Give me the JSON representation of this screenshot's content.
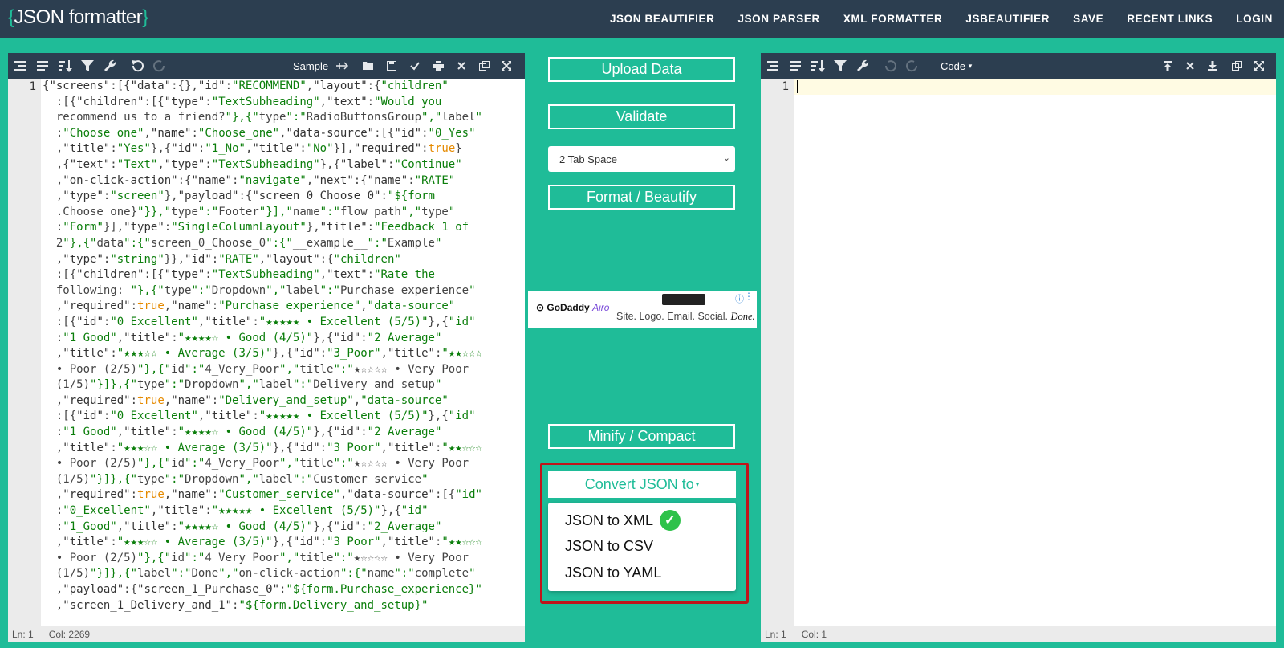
{
  "header": {
    "logo_open": "{",
    "logo_name": "JSON formatter",
    "logo_close": "}",
    "nav": [
      "JSON BEAUTIFIER",
      "JSON PARSER",
      "XML FORMATTER",
      "JSBEAUTIFIER",
      "SAVE",
      "RECENT LINKS",
      "LOGIN"
    ]
  },
  "left_editor": {
    "sample_label": "Sample",
    "line_number": "1",
    "status": {
      "ln": "Ln: 1",
      "col": "Col: 2269"
    }
  },
  "right_editor": {
    "mode_label": "Code",
    "line_number": "1",
    "status": {
      "ln": "Ln: 1",
      "col": "Col: 1"
    }
  },
  "actions": {
    "upload": "Upload Data",
    "validate": "Validate",
    "tab_select": "2 Tab Space",
    "format": "Format / Beautify",
    "minify": "Minify / Compact",
    "convert": "Convert JSON to",
    "convert_options": [
      "JSON to XML",
      "JSON to CSV",
      "JSON to YAML"
    ]
  },
  "ad": {
    "brand": "GoDaddy",
    "brand_suffix": "Airo",
    "tagline": "Site. Logo. Email. Social.",
    "tagline_end": "Done."
  },
  "code_lines": [
    "{\"screens\":[{\"data\":{},\"id\":\"RECOMMEND\",\"layout\":{\"children\"",
    "  :[{\"children\":[{\"type\":\"TextSubheading\",\"text\":\"Would you",
    "  recommend us to a friend?\"},{\"type\":\"RadioButtonsGroup\",\"label\"",
    "  :\"Choose one\",\"name\":\"Choose_one\",\"data-source\":[{\"id\":\"0_Yes\"",
    "  ,\"title\":\"Yes\"},{\"id\":\"1_No\",\"title\":\"No\"}],\"required\":true}",
    "  ,{\"text\":\"Text\",\"type\":\"TextSubheading\"},{\"label\":\"Continue\"",
    "  ,\"on-click-action\":{\"name\":\"navigate\",\"next\":{\"name\":\"RATE\"",
    "  ,\"type\":\"screen\"},\"payload\":{\"screen_0_Choose_0\":\"${form",
    "  .Choose_one}\"}},\"type\":\"Footer\"}],\"name\":\"flow_path\",\"type\"",
    "  :\"Form\"}],\"type\":\"SingleColumnLayout\"},\"title\":\"Feedback 1 of",
    "  2\"},{\"data\":{\"screen_0_Choose_0\":{\"__example__\":\"Example\"",
    "  ,\"type\":\"string\"}},\"id\":\"RATE\",\"layout\":{\"children\"",
    "  :[{\"children\":[{\"type\":\"TextSubheading\",\"text\":\"Rate the",
    "  following: \"},{\"type\":\"Dropdown\",\"label\":\"Purchase experience\"",
    "  ,\"required\":true,\"name\":\"Purchase_experience\",\"data-source\"",
    "  :[{\"id\":\"0_Excellent\",\"title\":\"★★★★★ • Excellent (5/5)\"},{\"id\"",
    "  :\"1_Good\",\"title\":\"★★★★☆ • Good (4/5)\"},{\"id\":\"2_Average\"",
    "  ,\"title\":\"★★★☆☆ • Average (3/5)\"},{\"id\":\"3_Poor\",\"title\":\"★★☆☆☆",
    "  • Poor (2/5)\"},{\"id\":\"4_Very_Poor\",\"title\":\"★☆☆☆☆ • Very Poor",
    "  (1/5)\"}]},{\"type\":\"Dropdown\",\"label\":\"Delivery and setup\"",
    "  ,\"required\":true,\"name\":\"Delivery_and_setup\",\"data-source\"",
    "  :[{\"id\":\"0_Excellent\",\"title\":\"★★★★★ • Excellent (5/5)\"},{\"id\"",
    "  :\"1_Good\",\"title\":\"★★★★☆ • Good (4/5)\"},{\"id\":\"2_Average\"",
    "  ,\"title\":\"★★★☆☆ • Average (3/5)\"},{\"id\":\"3_Poor\",\"title\":\"★★☆☆☆",
    "  • Poor (2/5)\"},{\"id\":\"4_Very_Poor\",\"title\":\"★☆☆☆☆ • Very Poor",
    "  (1/5)\"}]},{\"type\":\"Dropdown\",\"label\":\"Customer service\"",
    "  ,\"required\":true,\"name\":\"Customer_service\",\"data-source\":[{\"id\"",
    "  :\"0_Excellent\",\"title\":\"★★★★★ • Excellent (5/5)\"},{\"id\"",
    "  :\"1_Good\",\"title\":\"★★★★☆ • Good (4/5)\"},{\"id\":\"2_Average\"",
    "  ,\"title\":\"★★★☆☆ • Average (3/5)\"},{\"id\":\"3_Poor\",\"title\":\"★★☆☆☆",
    "  • Poor (2/5)\"},{\"id\":\"4_Very_Poor\",\"title\":\"★☆☆☆☆ • Very Poor",
    "  (1/5)\"}]},{\"label\":\"Done\",\"on-click-action\":{\"name\":\"complete\"",
    "  ,\"payload\":{\"screen_1_Purchase_0\":\"${form.Purchase_experience}\"",
    "  ,\"screen_1_Delivery_and_1\":\"${form.Delivery_and_setup}\""
  ],
  "colors": {
    "teal": "#1fbc98",
    "navy": "#2c3e50",
    "string": "#0b7e0b",
    "boolean": "#e58a00",
    "highlight": "#c0141a",
    "check": "#2ec24a"
  },
  "icons": {
    "left_toolbar": [
      "format-icon",
      "compact-icon",
      "sort-icon",
      "filter-icon",
      "wrench-icon",
      "undo-icon",
      "redo-icon"
    ],
    "left_right_toolbar": [
      "sample-icon",
      "open-folder-icon",
      "save-icon",
      "check-icon",
      "print-icon",
      "close-icon",
      "copy-icon",
      "fullscreen-icon"
    ],
    "right_toolbar": [
      "format-icon",
      "compact-icon",
      "sort-icon",
      "filter-icon",
      "wrench-icon",
      "undo-icon",
      "redo-icon",
      "upload-icon",
      "close-icon",
      "download-icon",
      "copy-icon",
      "fullscreen-icon"
    ]
  }
}
